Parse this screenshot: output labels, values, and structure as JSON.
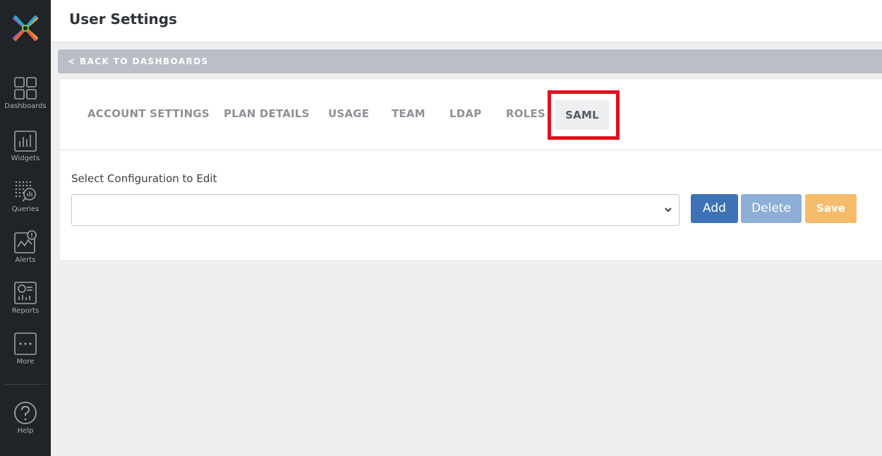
{
  "sidebar": {
    "items": [
      {
        "label": "Dashboards",
        "icon": "dashboards-icon"
      },
      {
        "label": "Widgets",
        "icon": "widgets-icon"
      },
      {
        "label": "Queries",
        "icon": "queries-icon"
      },
      {
        "label": "Alerts",
        "icon": "alerts-icon"
      },
      {
        "label": "Reports",
        "icon": "reports-icon"
      },
      {
        "label": "More",
        "icon": "more-icon"
      },
      {
        "label": "Help",
        "icon": "help-icon"
      }
    ]
  },
  "header": {
    "title": "User Settings"
  },
  "back_link": "< BACK TO DASHBOARDS",
  "tabs": [
    {
      "label": "ACCOUNT SETTINGS"
    },
    {
      "label": "PLAN DETAILS"
    },
    {
      "label": "USAGE"
    },
    {
      "label": "TEAM"
    },
    {
      "label": "LDAP"
    },
    {
      "label": "ROLES"
    },
    {
      "label": "SAML",
      "active": true
    }
  ],
  "form": {
    "label": "Select Configuration to Edit",
    "select_value": ""
  },
  "buttons": {
    "add": "Add",
    "delete": "Delete",
    "save": "Save"
  },
  "colors": {
    "sidebar_bg": "#202327",
    "primary": "#3d72b6",
    "delete": "#8eaed6",
    "save": "#f6bb6b",
    "highlight": "#e0111b"
  }
}
